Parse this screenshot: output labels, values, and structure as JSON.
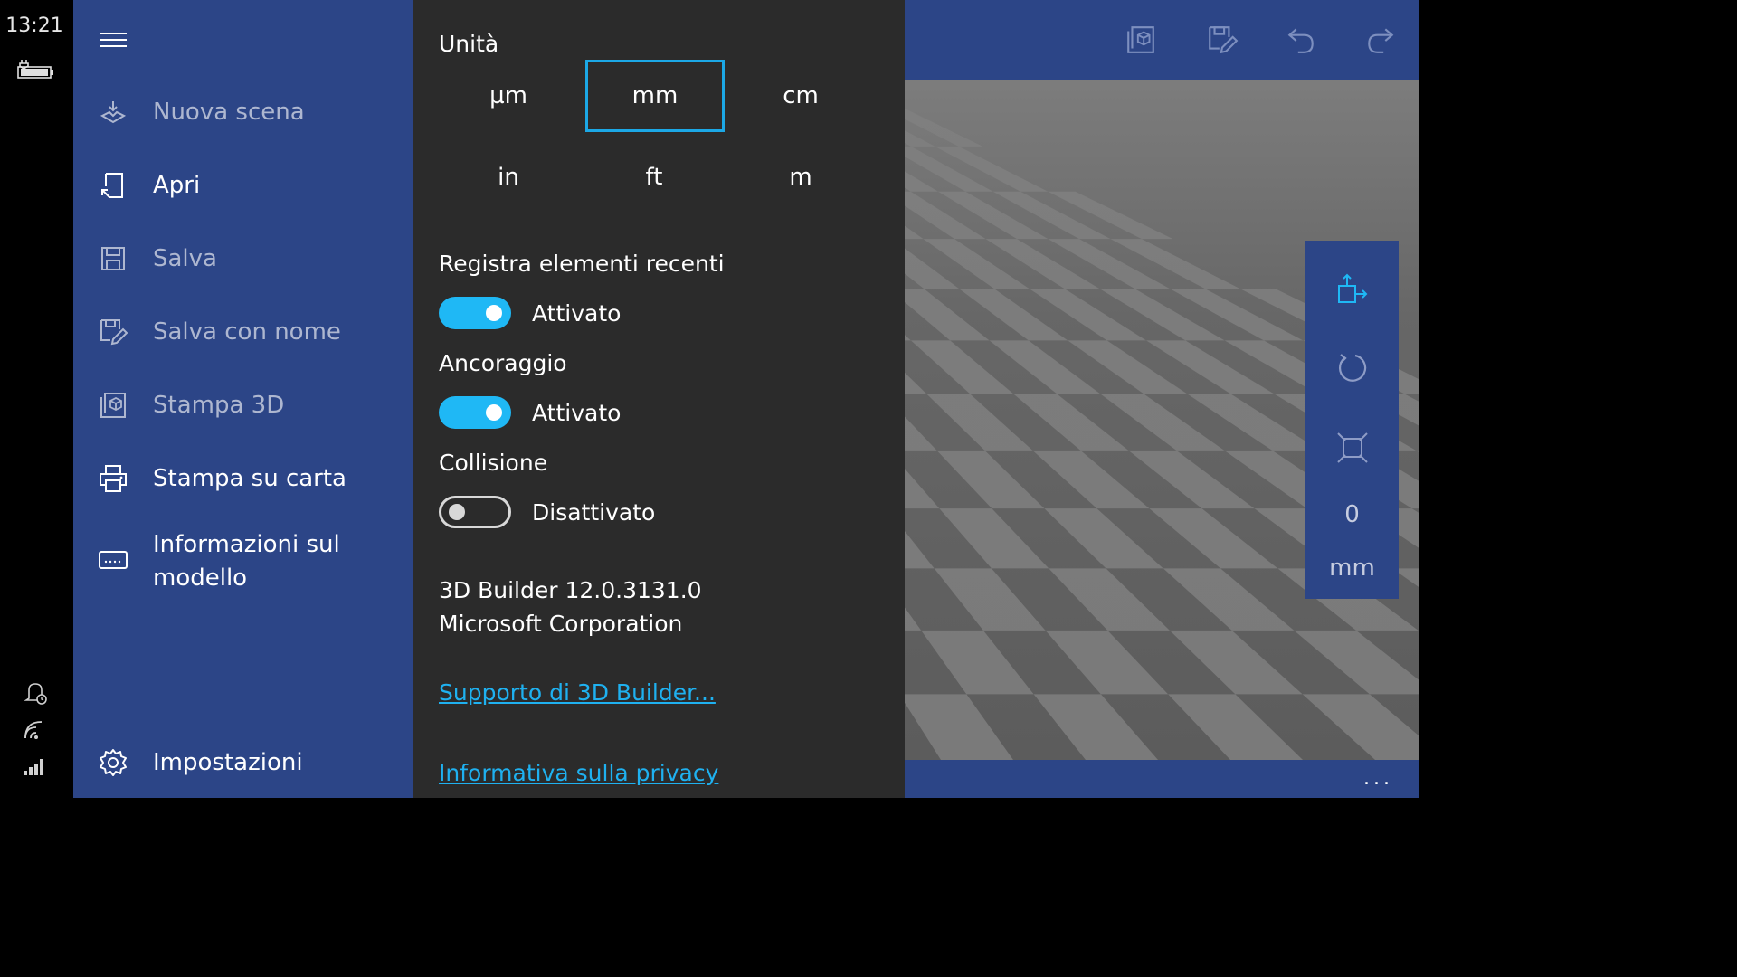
{
  "status": {
    "time": "13:21"
  },
  "nav": {
    "items": [
      {
        "label": "Nuova scena",
        "icon": "new-scene-icon",
        "enabled": false
      },
      {
        "label": "Apri",
        "icon": "open-icon",
        "enabled": true
      },
      {
        "label": "Salva",
        "icon": "save-icon",
        "enabled": false
      },
      {
        "label": "Salva con nome",
        "icon": "save-as-icon",
        "enabled": false
      },
      {
        "label": "Stampa 3D",
        "icon": "3d-print-icon",
        "enabled": false
      },
      {
        "label": "Stampa su carta",
        "icon": "printer-icon",
        "enabled": true
      },
      {
        "label": "Informazioni sul modello",
        "icon": "model-info-icon",
        "enabled": true
      }
    ],
    "settings_label": "Impostazioni"
  },
  "settings": {
    "units_label": "Unità",
    "units": [
      "µm",
      "mm",
      "cm",
      "in",
      "ft",
      "m"
    ],
    "selected_unit": "mm",
    "recent_label": "Registra elementi recenti",
    "recent_state": "Attivato",
    "snap_label": "Ancoraggio",
    "snap_state": "Attivato",
    "collision_label": "Collisione",
    "collision_state": "Disattivato",
    "version_line1": "3D Builder 12.0.3131.0",
    "version_line2": "Microsoft Corporation",
    "support_link": "Supporto di 3D Builder...",
    "privacy_link": "Informativa sulla privacy"
  },
  "viewport": {
    "measure_value": "0",
    "measure_unit": "mm",
    "more_label": "..."
  },
  "colors": {
    "nav_bg": "#2c4587",
    "panel_bg": "#2b2b2b",
    "accent": "#1fb8f5",
    "link": "#1fb1f0"
  }
}
